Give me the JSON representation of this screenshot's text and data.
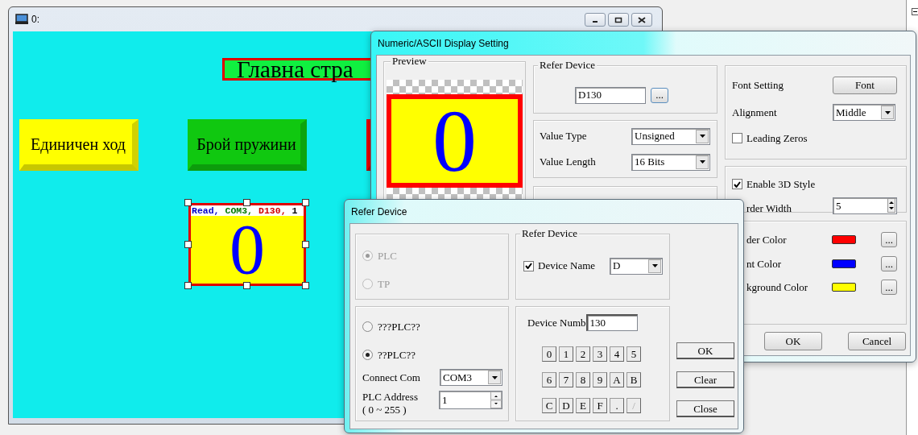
{
  "hmi_window": {
    "title": "0:",
    "screen": {
      "title_label": "Главна стра",
      "buttons": [
        {
          "label": "Единичен ход",
          "color": "#ffff00"
        },
        {
          "label": "Брой пружини",
          "color": "#10c810"
        },
        {
          "color": "#e80000"
        }
      ],
      "display_object": {
        "selected": true,
        "value": "0",
        "tag_parts": [
          {
            "text": "Read,",
            "color": "#0000c8"
          },
          {
            "text": "COM3,",
            "color": "#007800"
          },
          {
            "text": "D130,",
            "color": "#d00000"
          },
          {
            "text": "1",
            "color": "#000000"
          }
        ]
      }
    }
  },
  "settings_dialog": {
    "title": "Numeric/ASCII Display Setting",
    "preview": {
      "legend": "Preview",
      "value": "0"
    },
    "refer_device": {
      "legend": "Refer Device",
      "device": "D130",
      "browse_button": "..."
    },
    "value_type": {
      "label": "Value Type",
      "value": "Unsigned"
    },
    "value_length": {
      "label": "Value Length",
      "value": "16 Bits"
    },
    "font_setting": {
      "label": "Font Setting",
      "button": "Font"
    },
    "alignment": {
      "label": "Alignment",
      "value": "Middle"
    },
    "leading_zeros": {
      "label": "Leading Zeros",
      "checked": false
    },
    "enable_3d_style": {
      "label": "Enable 3D Style",
      "checked": true
    },
    "border_width": {
      "label": "rder Width",
      "value": "5"
    },
    "colors": [
      {
        "label": "der Color",
        "color": "#ff0000",
        "button": "..."
      },
      {
        "label": "nt Color",
        "color": "#0000ff",
        "button": "..."
      },
      {
        "label": "kground Color",
        "color": "#ffff00",
        "button": "..."
      }
    ],
    "buttons": [
      {
        "label": "OK"
      },
      {
        "label": "Cancel"
      }
    ]
  },
  "refer_dialog": {
    "title": "Refer Device",
    "source": [
      {
        "label": "PLC",
        "selected": true,
        "disabled": true
      },
      {
        "label": "TP",
        "selected": false,
        "disabled": true
      }
    ],
    "group_legend": "Refer Device",
    "device_name": {
      "label": "Device Name",
      "checked": true,
      "value": "D"
    },
    "link": [
      {
        "label": "???PLC??",
        "selected": false
      },
      {
        "label": "??PLC??",
        "selected": true
      }
    ],
    "connect_com": {
      "label": "Connect Com",
      "value": "COM3"
    },
    "plc_address": {
      "label": "PLC Address",
      "range": "( 0 ~ 255 )",
      "value": "1"
    },
    "device_number": {
      "label": "Device Numb",
      "value": "130"
    },
    "keys": [
      {
        "label": "0",
        "disabled": false
      },
      {
        "label": "1",
        "disabled": false
      },
      {
        "label": "2",
        "disabled": false
      },
      {
        "label": "3",
        "disabled": false
      },
      {
        "label": "4",
        "disabled": false
      },
      {
        "label": "5",
        "disabled": false
      },
      {
        "label": "6",
        "disabled": false
      },
      {
        "label": "7",
        "disabled": false
      },
      {
        "label": "8",
        "disabled": false
      },
      {
        "label": "9",
        "disabled": false
      },
      {
        "label": "A",
        "disabled": false
      },
      {
        "label": "B",
        "disabled": false
      },
      {
        "label": "C",
        "disabled": false
      },
      {
        "label": "D",
        "disabled": false
      },
      {
        "label": "E",
        "disabled": false
      },
      {
        "label": "F",
        "disabled": false
      },
      {
        "label": ".",
        "disabled": false
      },
      {
        "label": "/",
        "disabled": true
      }
    ],
    "buttons": [
      {
        "label": "OK"
      },
      {
        "label": "Clear"
      },
      {
        "label": "Close"
      }
    ]
  }
}
